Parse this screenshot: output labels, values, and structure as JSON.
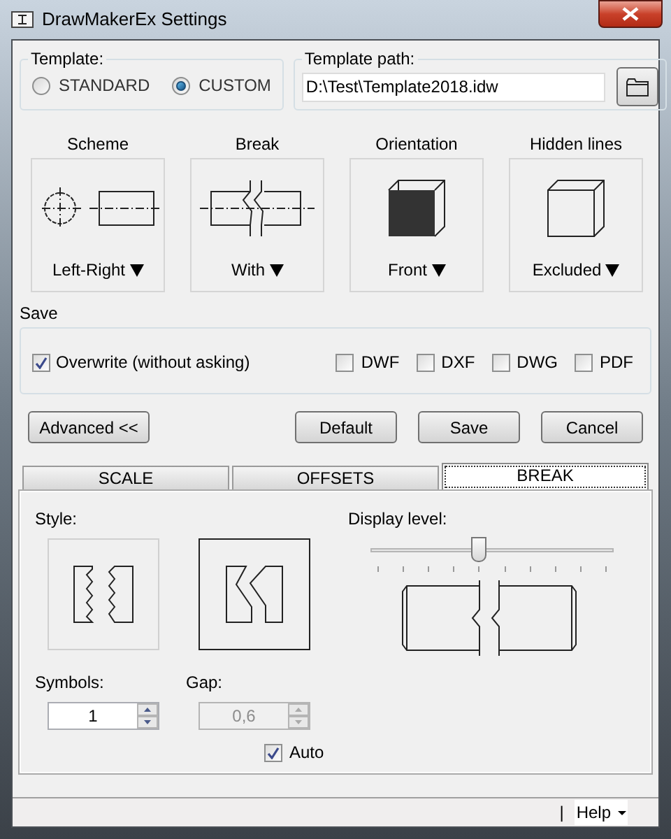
{
  "window": {
    "title": "DrawMakerEx Settings"
  },
  "template": {
    "label": "Template:",
    "options": [
      {
        "label": "STANDARD",
        "selected": false
      },
      {
        "label": "CUSTOM",
        "selected": true
      }
    ]
  },
  "template_path": {
    "label": "Template path:",
    "value": "D:\\Test\\Template2018.idw"
  },
  "options": [
    {
      "kind": "scheme",
      "title": "Scheme",
      "value": "Left-Right"
    },
    {
      "kind": "break",
      "title": "Break",
      "value": "With"
    },
    {
      "kind": "orientation",
      "title": "Orientation",
      "value": "Front"
    },
    {
      "kind": "hidden",
      "title": "Hidden lines",
      "value": "Excluded"
    }
  ],
  "save": {
    "label": "Save",
    "overwrite": {
      "label": "Overwrite (without asking)",
      "checked": true
    },
    "formats": [
      {
        "label": "DWF",
        "checked": false
      },
      {
        "label": "DXF",
        "checked": false
      },
      {
        "label": "DWG",
        "checked": false
      },
      {
        "label": "PDF",
        "checked": false
      }
    ]
  },
  "buttons": [
    {
      "label": "Advanced <<"
    },
    {
      "label": "Default"
    },
    {
      "label": "Save"
    },
    {
      "label": "Cancel"
    }
  ],
  "tabs": [
    {
      "label": "SCALE",
      "selected": false
    },
    {
      "label": "OFFSETS",
      "selected": false
    },
    {
      "label": "BREAK",
      "selected": true
    }
  ],
  "break_panel": {
    "style_label": "Style:",
    "styles": [
      {
        "kind": "zigzag",
        "selected": false
      },
      {
        "kind": "step",
        "selected": true
      }
    ],
    "display_level_label": "Display level:",
    "display_level": {
      "level": 0.44
    },
    "symbols": {
      "label": "Symbols:",
      "value": "1",
      "disabled": false
    },
    "gap": {
      "label": "Gap:",
      "value": "0,6",
      "disabled": true
    },
    "auto": {
      "label": "Auto",
      "checked": true
    }
  },
  "status_bar": {
    "separator": "|",
    "help": "Help"
  }
}
